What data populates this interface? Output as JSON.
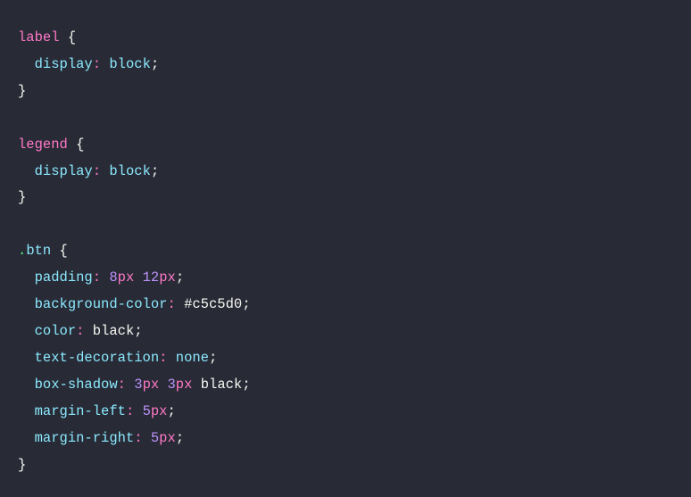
{
  "code": {
    "rules": [
      {
        "selector_type": "tag",
        "selector": "label",
        "declarations": [
          {
            "property": "display",
            "value_parts": [
              {
                "type": "keyword",
                "text": "block"
              }
            ]
          }
        ]
      },
      {
        "selector_type": "tag",
        "selector": "legend",
        "declarations": [
          {
            "property": "display",
            "value_parts": [
              {
                "type": "keyword",
                "text": "block"
              }
            ]
          }
        ]
      },
      {
        "selector_type": "class",
        "selector": ".btn",
        "declarations": [
          {
            "property": "padding",
            "value_parts": [
              {
                "type": "number",
                "text": "8"
              },
              {
                "type": "unit",
                "text": "px"
              },
              {
                "type": "space",
                "text": " "
              },
              {
                "type": "number",
                "text": "12"
              },
              {
                "type": "unit",
                "text": "px"
              }
            ]
          },
          {
            "property": "background-color",
            "value_parts": [
              {
                "type": "other",
                "text": "#c5c5d0"
              }
            ]
          },
          {
            "property": "color",
            "value_parts": [
              {
                "type": "other",
                "text": "black"
              }
            ]
          },
          {
            "property": "text-decoration",
            "value_parts": [
              {
                "type": "keyword",
                "text": "none"
              }
            ]
          },
          {
            "property": "box-shadow",
            "value_parts": [
              {
                "type": "number",
                "text": "3"
              },
              {
                "type": "unit",
                "text": "px"
              },
              {
                "type": "space",
                "text": " "
              },
              {
                "type": "number",
                "text": "3"
              },
              {
                "type": "unit",
                "text": "px"
              },
              {
                "type": "space",
                "text": " "
              },
              {
                "type": "other",
                "text": "black"
              }
            ]
          },
          {
            "property": "margin-left",
            "value_parts": [
              {
                "type": "number",
                "text": "5"
              },
              {
                "type": "unit",
                "text": "px"
              }
            ]
          },
          {
            "property": "margin-right",
            "value_parts": [
              {
                "type": "number",
                "text": "5"
              },
              {
                "type": "unit",
                "text": "px"
              }
            ]
          }
        ]
      }
    ]
  }
}
